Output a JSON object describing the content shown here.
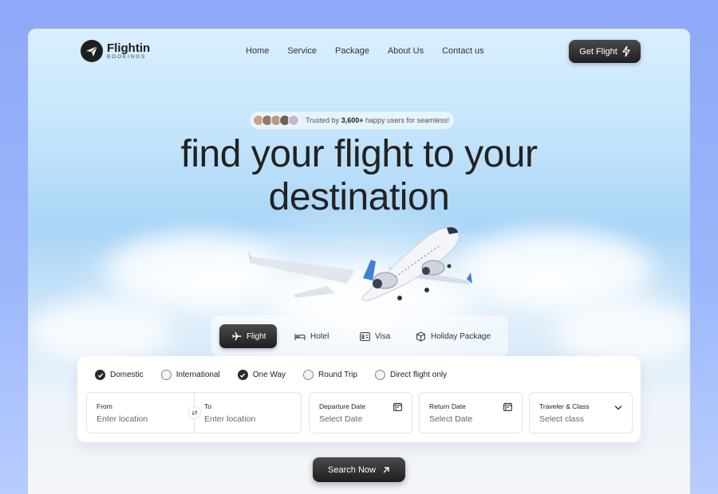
{
  "brand": {
    "name": "Flightin",
    "sub": "BOOKINGS"
  },
  "nav": [
    "Home",
    "Service",
    "Package",
    "About Us",
    "Contact us"
  ],
  "cta": {
    "label": "Get Flight"
  },
  "trust": {
    "prefix": "Trusted by",
    "count": "3,600+",
    "suffix": "happy users for seamless!"
  },
  "headline": {
    "line1": "find your flight to your",
    "line2": "destination"
  },
  "tabs": [
    "Flight",
    "Hotel",
    "Visa",
    "Holiday Package"
  ],
  "options": [
    {
      "label": "Domestic",
      "checked": true
    },
    {
      "label": "International",
      "checked": false
    },
    {
      "label": "One Way",
      "checked": true
    },
    {
      "label": "Round Trip",
      "checked": false
    },
    {
      "label": "Direct flight only",
      "checked": false
    }
  ],
  "fields": {
    "from": {
      "label": "From",
      "value": "Enter location"
    },
    "to": {
      "label": "To",
      "value": "Enter location"
    },
    "departure": {
      "label": "Departure Date",
      "value": "Select Date"
    },
    "return": {
      "label": "Return Date",
      "value": "Select Date"
    },
    "traveler": {
      "label": "Traveler & Class",
      "value": "Select class"
    }
  },
  "search": {
    "label": "Search Now"
  },
  "colors": {
    "dark": "#1f1f1f",
    "sky": "#a9d5f7",
    "page_bg": "#9cb6fb"
  }
}
